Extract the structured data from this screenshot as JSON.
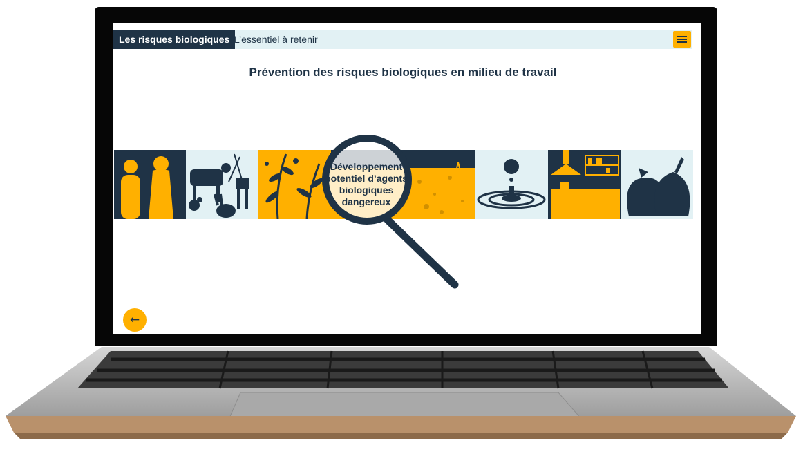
{
  "header": {
    "course_title": "Les risques biologiques",
    "section_title": "L’essentiel à retenir",
    "menu_icon": "hamburger-menu-icon"
  },
  "main": {
    "title": "Prévention des risques biologiques en milieu de travail",
    "magnifier_text": [
      "Développement",
      "potentiel d’agents",
      "biologiques",
      "dangereux"
    ]
  },
  "navigation": {
    "back_icon": "arrow-left-icon",
    "back_glyph": "←"
  },
  "illustrations": [
    "people",
    "animals",
    "plants",
    "soil",
    "water-droplet",
    "buildings",
    "waste-bags"
  ],
  "colors": {
    "navy": "#1f3346",
    "accent": "#ffb000",
    "light_blue": "#e2f1f4"
  }
}
